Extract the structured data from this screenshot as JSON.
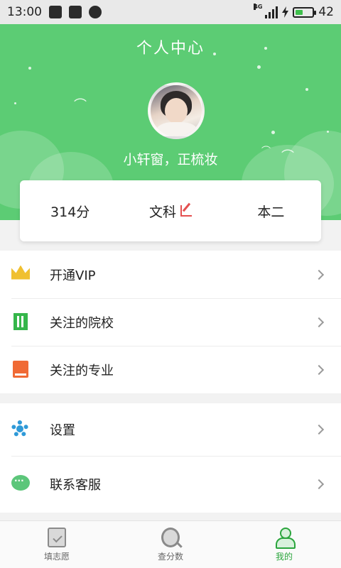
{
  "status_bar": {
    "time": "13:00",
    "network": "4G",
    "battery": "42",
    "battery_level": 0.42
  },
  "header": {
    "title": "个人中心",
    "username": "小轩窗，正梳妆"
  },
  "stats": {
    "score": "314分",
    "subject": "文科",
    "level": "本二"
  },
  "menu_group1": [
    {
      "label": "开通VIP",
      "icon": "crown-icon"
    },
    {
      "label": "关注的院校",
      "icon": "building-icon"
    },
    {
      "label": "关注的专业",
      "icon": "book-icon"
    }
  ],
  "menu_group2": [
    {
      "label": "设置",
      "icon": "gear-icon"
    },
    {
      "label": "联系客服",
      "icon": "chat-icon"
    }
  ],
  "bottom_nav": [
    {
      "label": "填志愿",
      "icon": "form-icon",
      "active": false
    },
    {
      "label": "查分数",
      "icon": "search-icon",
      "active": false
    },
    {
      "label": "我的",
      "icon": "user-icon",
      "active": true
    }
  ],
  "colors": {
    "primary_green": "#5ccc74",
    "active_tab": "#2aa53c",
    "edit_red": "#e45050"
  }
}
